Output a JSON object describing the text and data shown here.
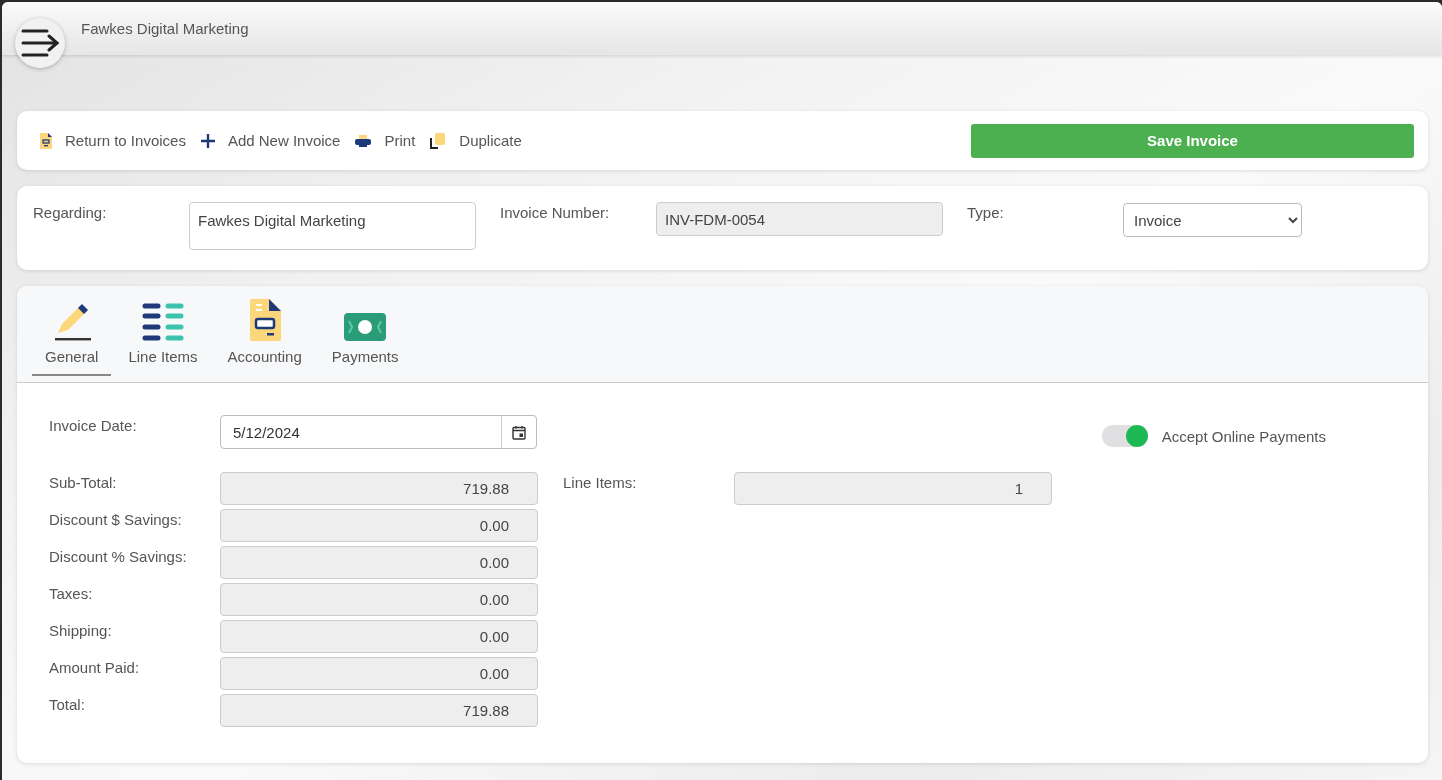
{
  "header": {
    "title": "Fawkes Digital Marketing"
  },
  "toolbar": {
    "actions": [
      {
        "kind": "return",
        "label": "Return to Invoices"
      },
      {
        "kind": "add",
        "label": "Add New Invoice"
      },
      {
        "kind": "print",
        "label": "Print"
      },
      {
        "kind": "duplicate",
        "label": "Duplicate"
      }
    ],
    "save_button": "Save Invoice"
  },
  "details": {
    "regarding": {
      "label": "Regarding:",
      "value": "Fawkes Digital Marketing"
    },
    "invoice_number": {
      "label": "Invoice Number:",
      "value": "INV-FDM-0054"
    },
    "type": {
      "label": "Type:",
      "value": "Invoice"
    }
  },
  "tabs": [
    {
      "kind": "pencil",
      "label": "General",
      "selected": true
    },
    {
      "kind": "list",
      "label": "Line Items",
      "selected": false
    },
    {
      "kind": "document",
      "label": "Accounting",
      "selected": false
    },
    {
      "kind": "money",
      "label": "Payments",
      "selected": false
    }
  ],
  "general": {
    "invoice_date": {
      "label": "Invoice Date:",
      "value": "5/12/2024"
    },
    "accept_online_payments": {
      "label": "Accept Online Payments",
      "on": true
    },
    "totals": [
      {
        "label": "Sub-Total:",
        "value": "719.88"
      },
      {
        "label": "Discount $ Savings:",
        "value": "0.00"
      },
      {
        "label": "Discount % Savings:",
        "value": "0.00"
      },
      {
        "label": "Taxes:",
        "value": "0.00"
      },
      {
        "label": "Shipping:",
        "value": "0.00"
      },
      {
        "label": "Amount Paid:",
        "value": "0.00"
      },
      {
        "label": "Total:",
        "value": "719.88"
      }
    ],
    "line_items": {
      "label": "Line Items:",
      "value": "1"
    }
  }
}
